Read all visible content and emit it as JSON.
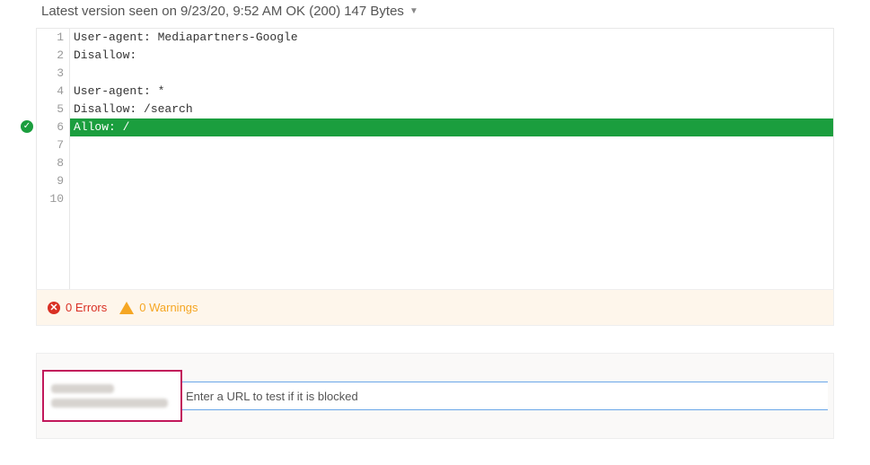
{
  "status": {
    "prefix": "Latest version seen on",
    "date": "9/23/20, 9:52 AM",
    "status_text": "OK (200)",
    "size_text": "147 Bytes"
  },
  "editor": {
    "highlighted_line_index": 5,
    "lines": [
      "User-agent: Mediapartners-Google",
      "Disallow:",
      "",
      "User-agent: *",
      "Disallow: /search",
      "Allow: /",
      "",
      "",
      "",
      ""
    ]
  },
  "messages": {
    "errors_count": "0",
    "errors_label": "Errors",
    "warnings_count": "0",
    "warnings_label": "Warnings"
  },
  "test": {
    "placeholder": "Enter a URL to test if it is blocked"
  }
}
